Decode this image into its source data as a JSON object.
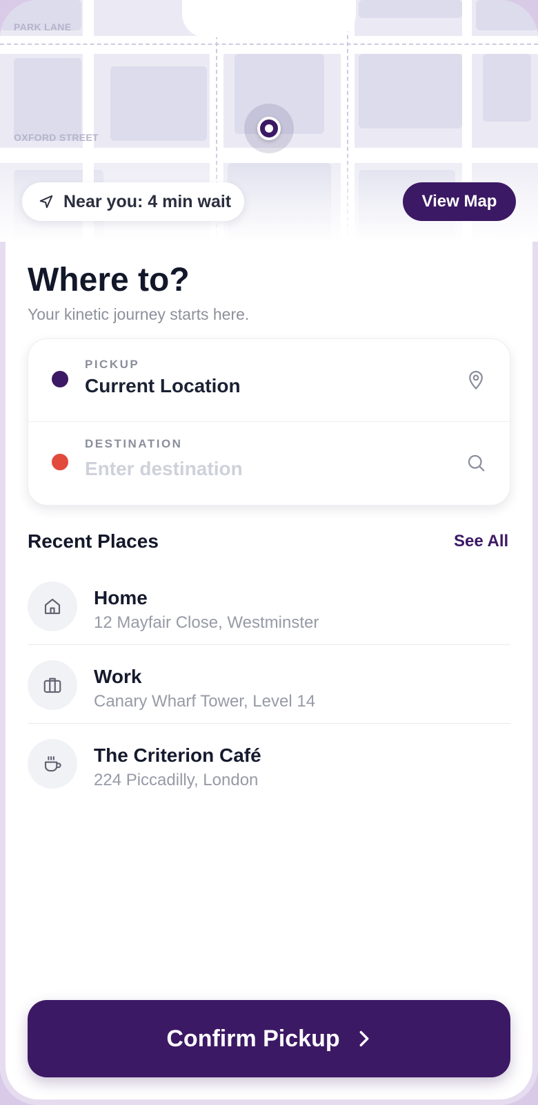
{
  "map": {
    "streets": [
      "PARK LANE",
      "OXFORD STREET"
    ],
    "wait_badge": "Near you: 4 min wait",
    "view_map_label": "View Map"
  },
  "header": {
    "title": "Where to?",
    "subtitle": "Your kinetic journey starts here."
  },
  "pickup": {
    "label": "PICKUP",
    "value": "Current Location",
    "dot_color": "#3c1964",
    "icon": "map-pin-icon"
  },
  "destination": {
    "label": "DESTINATION",
    "value": "",
    "placeholder": "Enter destination",
    "dot_color": "#e24a3b",
    "icon": "search-icon"
  },
  "recent": {
    "title": "Recent Places",
    "see_all": "See All",
    "items": [
      {
        "name": "Home",
        "address": "12 Mayfair Close, Westminster",
        "icon": "home-icon"
      },
      {
        "name": "Work",
        "address": "Canary Wharf Tower, Level 14",
        "icon": "briefcase-icon"
      },
      {
        "name": "The Criterion Café",
        "address": "224 Piccadilly, London",
        "icon": "coffee-cup-icon"
      }
    ]
  },
  "confirm": {
    "label": "Confirm Pickup",
    "icon": "chevron-right-icon"
  },
  "colors": {
    "primary": "#3c1964",
    "destination_dot": "#e24a3b",
    "map_background": "#ebeaf4"
  }
}
